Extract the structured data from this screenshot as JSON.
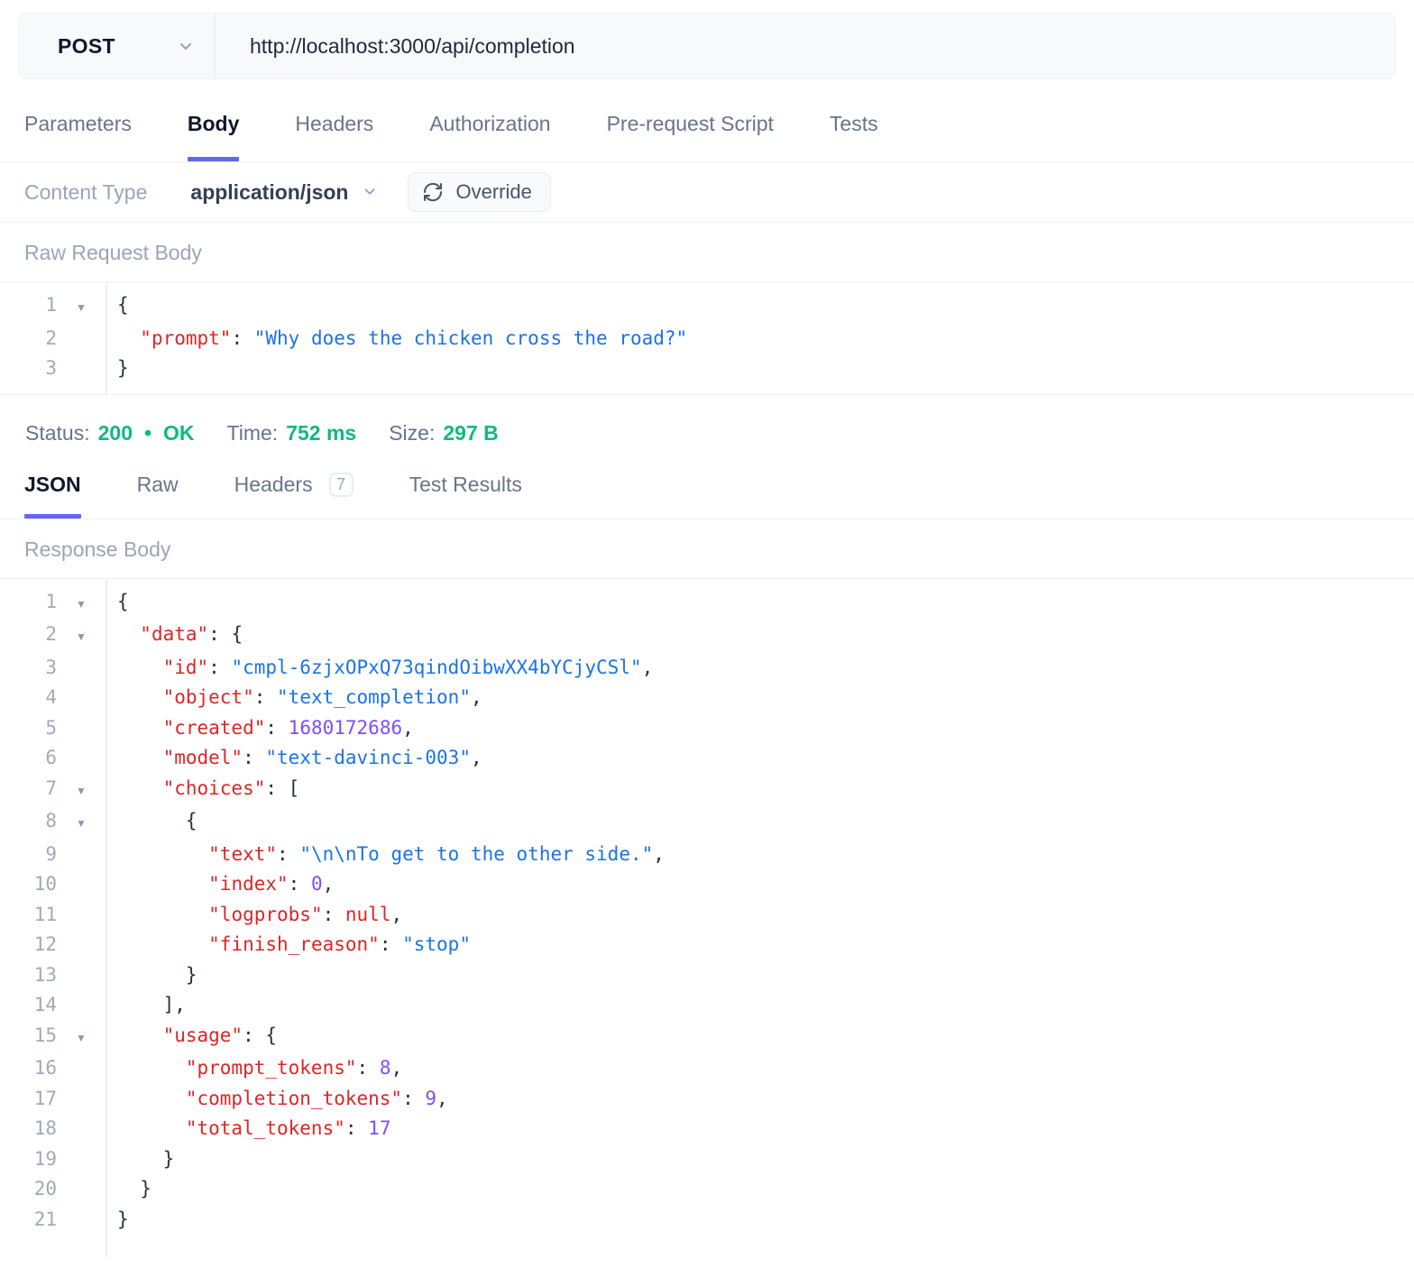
{
  "request_bar": {
    "method": "POST",
    "url": "http://localhost:3000/api/completion"
  },
  "request_tabs": {
    "items": [
      {
        "label": "Parameters"
      },
      {
        "label": "Body",
        "active": true
      },
      {
        "label": "Headers"
      },
      {
        "label": "Authorization"
      },
      {
        "label": "Pre-request Script"
      },
      {
        "label": "Tests"
      }
    ]
  },
  "content_type": {
    "label": "Content Type",
    "value": "application/json",
    "override_label": "Override"
  },
  "request_body": {
    "heading": "Raw Request Body",
    "lines": [
      {
        "n": "1",
        "fold": true,
        "seg": [
          {
            "t": "{",
            "c": "p"
          }
        ]
      },
      {
        "n": "2",
        "fold": false,
        "seg": [
          {
            "t": "  ",
            "c": "p"
          },
          {
            "t": "\"prompt\"",
            "c": "k"
          },
          {
            "t": ": ",
            "c": "p"
          },
          {
            "t": "\"Why does the chicken cross the road?\"",
            "c": "s"
          }
        ]
      },
      {
        "n": "3",
        "fold": false,
        "seg": [
          {
            "t": "}",
            "c": "p"
          }
        ]
      }
    ]
  },
  "status_bar": {
    "status_label": "Status:",
    "status_code": "200",
    "separator": "•",
    "status_text": "OK",
    "time_label": "Time:",
    "time_value": "752 ms",
    "size_label": "Size:",
    "size_value": "297 B"
  },
  "response_tabs": {
    "items": [
      {
        "label": "JSON",
        "active": true
      },
      {
        "label": "Raw"
      },
      {
        "label": "Headers",
        "badge": "7"
      },
      {
        "label": "Test Results"
      }
    ]
  },
  "response_body": {
    "heading": "Response Body",
    "lines": [
      {
        "n": "1",
        "fold": true,
        "seg": [
          {
            "t": "{",
            "c": "p"
          }
        ]
      },
      {
        "n": "2",
        "fold": true,
        "seg": [
          {
            "t": "  ",
            "c": "p"
          },
          {
            "t": "\"data\"",
            "c": "k"
          },
          {
            "t": ": {",
            "c": "p"
          }
        ]
      },
      {
        "n": "3",
        "fold": false,
        "seg": [
          {
            "t": "    ",
            "c": "p"
          },
          {
            "t": "\"id\"",
            "c": "k"
          },
          {
            "t": ": ",
            "c": "p"
          },
          {
            "t": "\"cmpl-6zjxOPxQ73qindOibwXX4bYCjyCSl\"",
            "c": "s"
          },
          {
            "t": ",",
            "c": "p"
          }
        ]
      },
      {
        "n": "4",
        "fold": false,
        "seg": [
          {
            "t": "    ",
            "c": "p"
          },
          {
            "t": "\"object\"",
            "c": "k"
          },
          {
            "t": ": ",
            "c": "p"
          },
          {
            "t": "\"text_completion\"",
            "c": "s"
          },
          {
            "t": ",",
            "c": "p"
          }
        ]
      },
      {
        "n": "5",
        "fold": false,
        "seg": [
          {
            "t": "    ",
            "c": "p"
          },
          {
            "t": "\"created\"",
            "c": "k"
          },
          {
            "t": ": ",
            "c": "p"
          },
          {
            "t": "1680172686",
            "c": "n"
          },
          {
            "t": ",",
            "c": "p"
          }
        ]
      },
      {
        "n": "6",
        "fold": false,
        "seg": [
          {
            "t": "    ",
            "c": "p"
          },
          {
            "t": "\"model\"",
            "c": "k"
          },
          {
            "t": ": ",
            "c": "p"
          },
          {
            "t": "\"text-davinci-003\"",
            "c": "s"
          },
          {
            "t": ",",
            "c": "p"
          }
        ]
      },
      {
        "n": "7",
        "fold": true,
        "seg": [
          {
            "t": "    ",
            "c": "p"
          },
          {
            "t": "\"choices\"",
            "c": "k"
          },
          {
            "t": ": [",
            "c": "p"
          }
        ]
      },
      {
        "n": "8",
        "fold": true,
        "seg": [
          {
            "t": "      {",
            "c": "p"
          }
        ]
      },
      {
        "n": "9",
        "fold": false,
        "seg": [
          {
            "t": "        ",
            "c": "p"
          },
          {
            "t": "\"text\"",
            "c": "k"
          },
          {
            "t": ": ",
            "c": "p"
          },
          {
            "t": "\"\\n\\nTo get to the other side.\"",
            "c": "s"
          },
          {
            "t": ",",
            "c": "p"
          }
        ]
      },
      {
        "n": "10",
        "fold": false,
        "seg": [
          {
            "t": "        ",
            "c": "p"
          },
          {
            "t": "\"index\"",
            "c": "k"
          },
          {
            "t": ": ",
            "c": "p"
          },
          {
            "t": "0",
            "c": "n"
          },
          {
            "t": ",",
            "c": "p"
          }
        ]
      },
      {
        "n": "11",
        "fold": false,
        "seg": [
          {
            "t": "        ",
            "c": "p"
          },
          {
            "t": "\"logprobs\"",
            "c": "k"
          },
          {
            "t": ": ",
            "c": "p"
          },
          {
            "t": "null",
            "c": "x"
          },
          {
            "t": ",",
            "c": "p"
          }
        ]
      },
      {
        "n": "12",
        "fold": false,
        "seg": [
          {
            "t": "        ",
            "c": "p"
          },
          {
            "t": "\"finish_reason\"",
            "c": "k"
          },
          {
            "t": ": ",
            "c": "p"
          },
          {
            "t": "\"stop\"",
            "c": "s"
          }
        ]
      },
      {
        "n": "13",
        "fold": false,
        "seg": [
          {
            "t": "      }",
            "c": "p"
          }
        ]
      },
      {
        "n": "14",
        "fold": false,
        "seg": [
          {
            "t": "    ],",
            "c": "p"
          }
        ]
      },
      {
        "n": "15",
        "fold": true,
        "seg": [
          {
            "t": "    ",
            "c": "p"
          },
          {
            "t": "\"usage\"",
            "c": "k"
          },
          {
            "t": ": {",
            "c": "p"
          }
        ]
      },
      {
        "n": "16",
        "fold": false,
        "seg": [
          {
            "t": "      ",
            "c": "p"
          },
          {
            "t": "\"prompt_tokens\"",
            "c": "k"
          },
          {
            "t": ": ",
            "c": "p"
          },
          {
            "t": "8",
            "c": "n"
          },
          {
            "t": ",",
            "c": "p"
          }
        ]
      },
      {
        "n": "17",
        "fold": false,
        "seg": [
          {
            "t": "      ",
            "c": "p"
          },
          {
            "t": "\"completion_tokens\"",
            "c": "k"
          },
          {
            "t": ": ",
            "c": "p"
          },
          {
            "t": "9",
            "c": "n"
          },
          {
            "t": ",",
            "c": "p"
          }
        ]
      },
      {
        "n": "18",
        "fold": false,
        "seg": [
          {
            "t": "      ",
            "c": "p"
          },
          {
            "t": "\"total_tokens\"",
            "c": "k"
          },
          {
            "t": ": ",
            "c": "p"
          },
          {
            "t": "17",
            "c": "n"
          }
        ]
      },
      {
        "n": "19",
        "fold": false,
        "seg": [
          {
            "t": "    }",
            "c": "p"
          }
        ]
      },
      {
        "n": "20",
        "fold": false,
        "seg": [
          {
            "t": "  }",
            "c": "p"
          }
        ]
      },
      {
        "n": "21",
        "fold": false,
        "seg": [
          {
            "t": "}",
            "c": "p"
          }
        ]
      }
    ]
  },
  "colors": {
    "accent": "#6366f1",
    "success": "#10b981",
    "key": "#dc2626",
    "string": "#1a73e8",
    "number": "#7c4dff",
    "null": "#dc2626",
    "punctuation": "#263238"
  }
}
